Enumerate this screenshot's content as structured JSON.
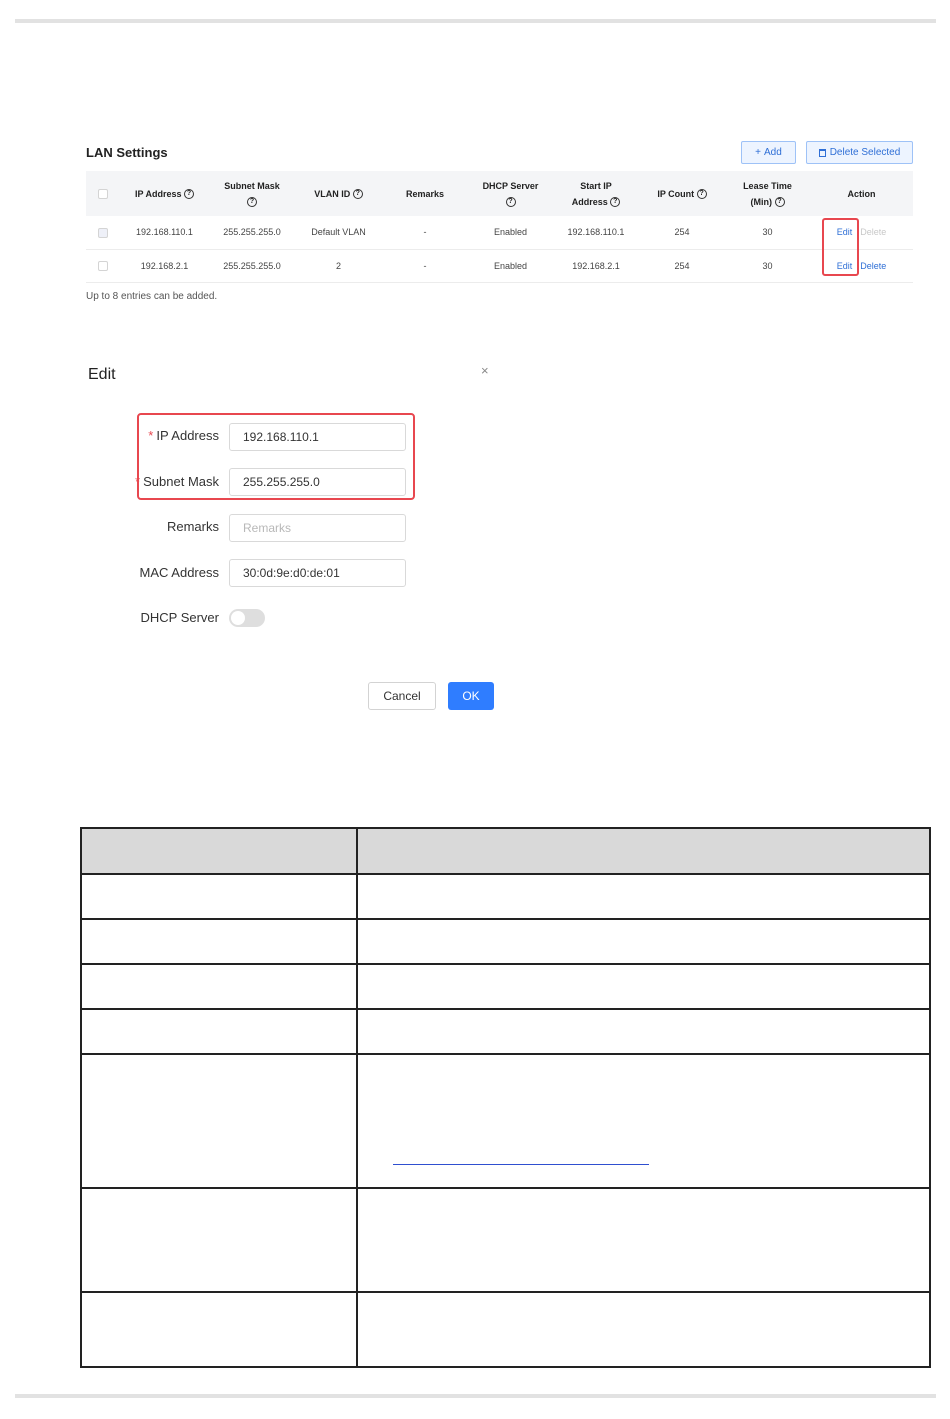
{
  "lan": {
    "title": "LAN Settings",
    "add_label": "Add",
    "add_icon": "+",
    "delete_selected_label": "Delete Selected",
    "columns": {
      "ip_address": "IP Address",
      "subnet_mask": "Subnet Mask",
      "vlan_id": "VLAN ID",
      "remarks": "Remarks",
      "dhcp_server": "DHCP Server",
      "start_ip_line1": "Start IP",
      "start_ip_line2": "Address",
      "ip_count": "IP Count",
      "lease_line1": "Lease Time",
      "lease_line2": "(Min)",
      "action": "Action"
    },
    "help_glyph": "?",
    "rows": [
      {
        "ip": "192.168.110.1",
        "mask": "255.255.255.0",
        "vlan": "Default VLAN",
        "remarks": "-",
        "dhcp": "Enabled",
        "start": "192.168.110.1",
        "count": "254",
        "lease": "30",
        "edit": "Edit",
        "delete": "Delete"
      },
      {
        "ip": "192.168.2.1",
        "mask": "255.255.255.0",
        "vlan": "2",
        "remarks": "-",
        "dhcp": "Enabled",
        "start": "192.168.2.1",
        "count": "254",
        "lease": "30",
        "edit": "Edit",
        "delete": "Delete"
      }
    ],
    "note": "Up to 8 entries can be added."
  },
  "dialog": {
    "title": "Edit",
    "close_glyph": "×",
    "required_mark": "*",
    "ip_label": "IP Address",
    "ip_value": "192.168.110.1",
    "mask_label": "Subnet Mask",
    "mask_value": "255.255.255.0",
    "remarks_label": "Remarks",
    "remarks_placeholder": "Remarks",
    "mac_label": "MAC Address",
    "mac_value": "30:0d:9e:d0:de:01",
    "dhcp_label": "DHCP Server",
    "dhcp_enabled": false,
    "cancel_label": "Cancel",
    "ok_label": "OK"
  },
  "colors": {
    "accent": "#2f7dff",
    "highlight": "#e8474f"
  }
}
